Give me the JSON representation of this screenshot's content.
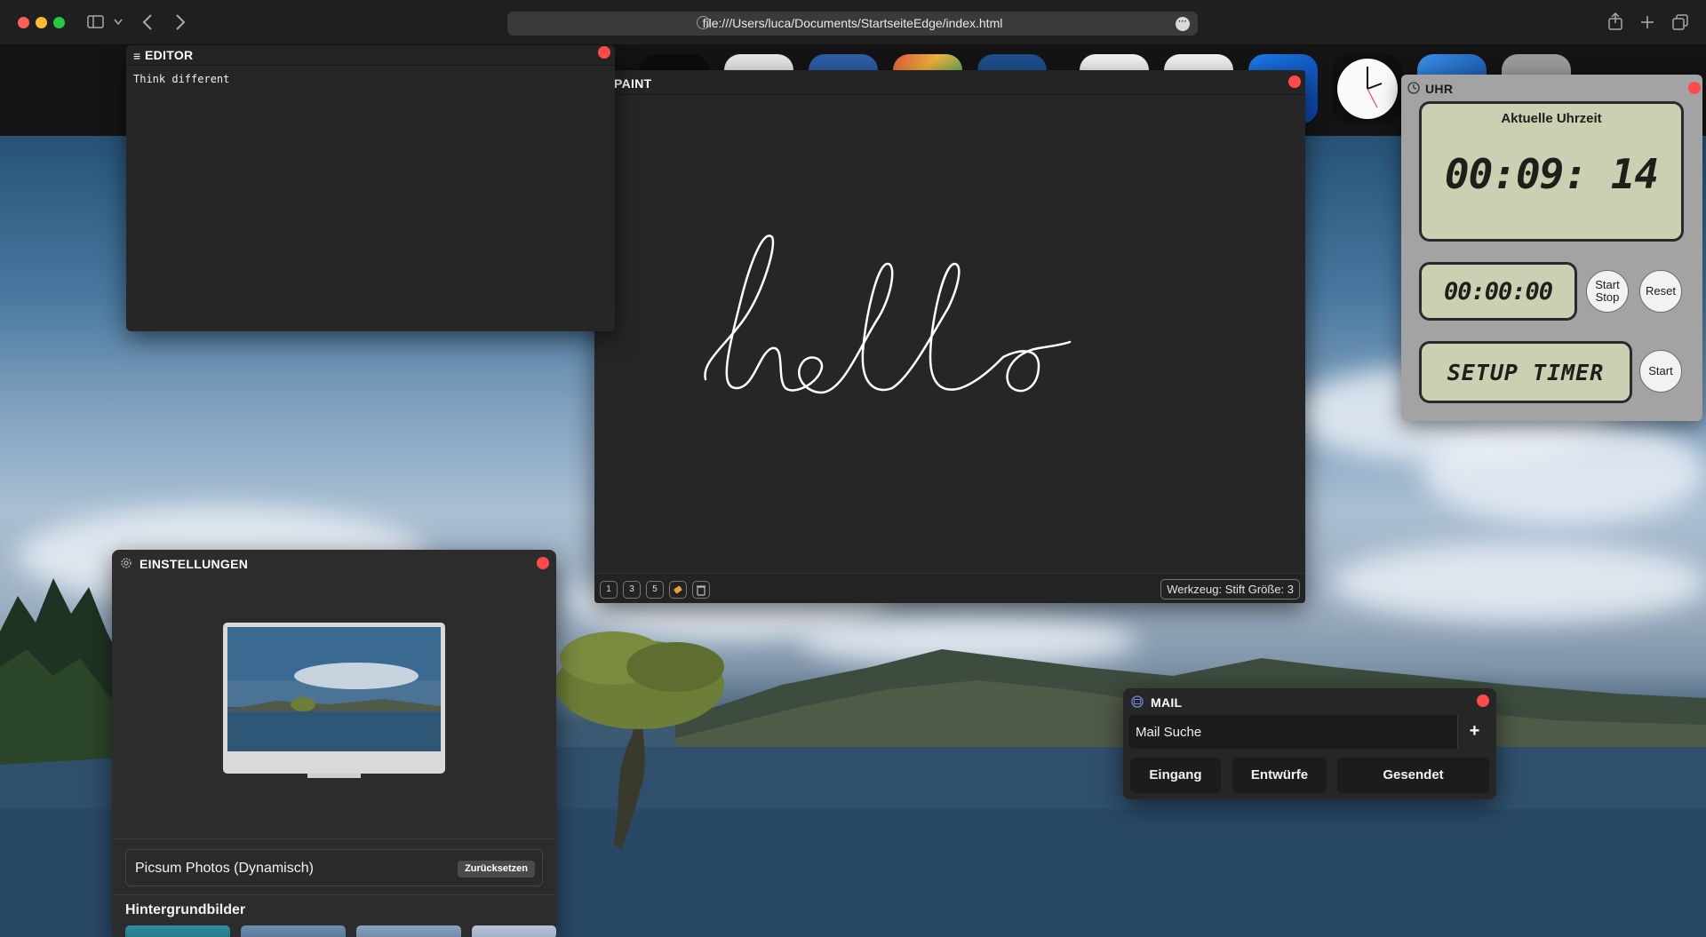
{
  "browser": {
    "url": "file:///Users/luca/Documents/StartseiteEdge/index.html",
    "back_icon": "chevron-left-icon",
    "forward_icon": "chevron-right-icon"
  },
  "editor": {
    "title": "EDITOR",
    "content": "Think different"
  },
  "paint": {
    "title": "PAINT",
    "drawing_text": "hello",
    "sizes": [
      "1",
      "3",
      "5"
    ],
    "status": "Werkzeug: Stift   Größe: 3"
  },
  "uhr": {
    "title": "UHR",
    "current_time_label": "Aktuelle Uhrzeit",
    "current_time": "00:09: 14",
    "stopwatch": "00:00:00",
    "start_stop_label_1": "Start",
    "start_stop_label_2": "Stop",
    "reset_label": "Reset",
    "timer_display": "SETUP TIMER",
    "timer_start_label": "Start"
  },
  "settings": {
    "title": "EINSTELLUNGEN",
    "source_label": "Picsum Photos (Dynamisch)",
    "reset_label": "Zurücksetzen",
    "backgrounds_heading": "Hintergrundbilder"
  },
  "mail": {
    "title": "MAIL",
    "search_placeholder": "Mail Suche",
    "add_label": "+",
    "buttons": [
      "Eingang",
      "Entwürfe",
      "Gesendet"
    ]
  },
  "colors": {
    "close": "#ff4a4a",
    "lcd": "#c9d1b2",
    "window_bg": "#232323"
  }
}
